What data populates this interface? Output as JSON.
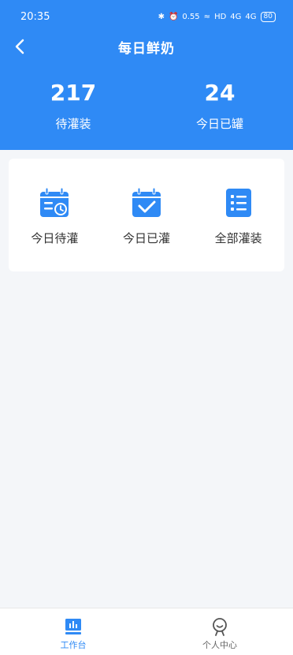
{
  "status_bar": {
    "time": "20:35",
    "speed": "0.55",
    "network": "HD",
    "signal1": "4G",
    "signal2": "4G",
    "battery": "80"
  },
  "nav": {
    "title": "每日鲜奶",
    "back_icon": "chevron-left-icon"
  },
  "stats": [
    {
      "value": "217",
      "label": "待灌装"
    },
    {
      "value": "24",
      "label": "今日已罐"
    }
  ],
  "actions": [
    {
      "label": "今日待灌",
      "icon": "calendar-clock-icon"
    },
    {
      "label": "今日已灌",
      "icon": "calendar-check-icon"
    },
    {
      "label": "全部灌装",
      "icon": "list-icon"
    }
  ],
  "tabs": [
    {
      "label": "工作台",
      "icon": "dashboard-icon",
      "active": true
    },
    {
      "label": "个人中心",
      "icon": "user-icon",
      "active": false
    }
  ],
  "colors": {
    "primary": "#2f8af5",
    "background": "#f4f6f9",
    "card": "#ffffff",
    "text": "#333333"
  }
}
